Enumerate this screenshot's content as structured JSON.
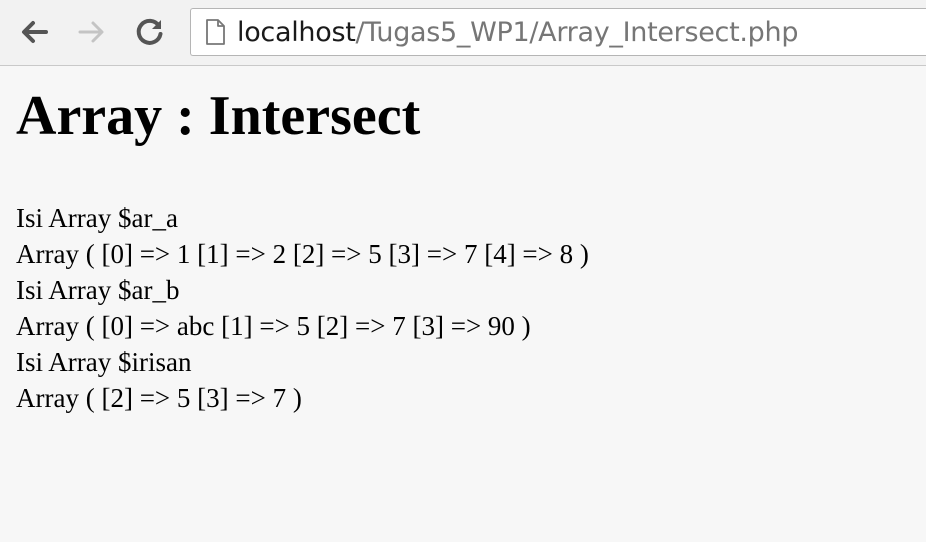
{
  "browser": {
    "url_host": "localhost",
    "url_path": "/Tugas5_WP1/Array_Intersect.php",
    "icons": {
      "back": "back-arrow-icon",
      "forward": "forward-arrow-icon",
      "reload": "reload-icon",
      "page": "page-icon"
    }
  },
  "page": {
    "title": "Array : Intersect",
    "lines": [
      "Isi Array $ar_a",
      "Array ( [0] => 1 [1] => 2 [2] => 5 [3] => 7 [4] => 8 )",
      "Isi Array $ar_b",
      "Array ( [0] => abc [1] => 5 [2] => 7 [3] => 90 )",
      "Isi Array $irisan",
      "Array ( [2] => 5 [3] => 7 )"
    ]
  }
}
